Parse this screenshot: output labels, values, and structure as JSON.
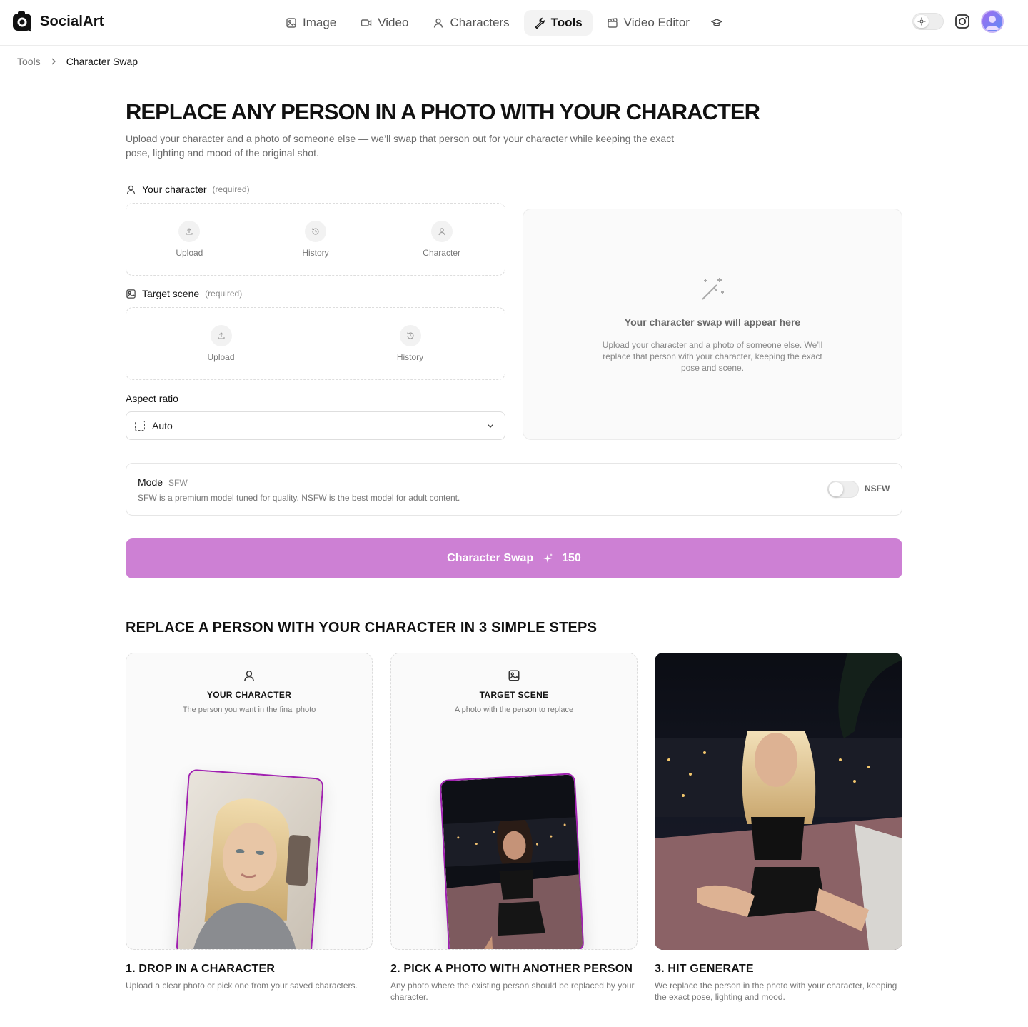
{
  "brand": {
    "name": "SocialArt"
  },
  "nav": {
    "items": [
      {
        "label": "Image",
        "icon": "image-icon"
      },
      {
        "label": "Video",
        "icon": "video-icon"
      },
      {
        "label": "Characters",
        "icon": "user-icon"
      },
      {
        "label": "Tools",
        "icon": "wrench-icon",
        "active": true
      },
      {
        "label": "Video Editor",
        "icon": "clapper-icon"
      }
    ],
    "extra_icon": "graduation-cap-icon"
  },
  "breadcrumb": {
    "parent": "Tools",
    "current": "Character Swap"
  },
  "hero": {
    "title": "REPLACE ANY PERSON IN A PHOTO WITH YOUR CHARACTER",
    "subtitle": "Upload your character and a photo of someone else — we’ll swap that person out for your character while keeping the exact pose, lighting and mood of the original shot."
  },
  "character_input": {
    "label": "Your character",
    "required": "(required)",
    "options": [
      "Upload",
      "History",
      "Character"
    ]
  },
  "scene_input": {
    "label": "Target scene",
    "required": "(required)",
    "options": [
      "Upload",
      "History"
    ]
  },
  "aspect_ratio": {
    "label": "Aspect ratio",
    "value": "Auto"
  },
  "preview": {
    "title": "Your character swap will appear here",
    "description": "Upload your character and a photo of someone else. We’ll replace that person with your character, keeping the exact pose and scene."
  },
  "mode": {
    "label": "Mode",
    "current": "SFW",
    "description": "SFW is a premium model tuned for quality. NSFW is the best model for adult content.",
    "toggle_label": "NSFW",
    "toggle_on": false
  },
  "cta": {
    "label": "Character Swap",
    "cost": "150",
    "color": "#cd80d4"
  },
  "steps": {
    "title": "REPLACE A PERSON WITH YOUR CHARACTER IN 3 SIMPLE STEPS",
    "cards": [
      {
        "title": "YOUR CHARACTER",
        "subtitle": "The person you want in the final photo"
      },
      {
        "title": "TARGET SCENE",
        "subtitle": "A photo with the person to replace"
      }
    ],
    "captions": [
      {
        "title": "1. DROP IN A CHARACTER",
        "desc": "Upload a clear photo or pick one from your saved characters."
      },
      {
        "title": "2. PICK A PHOTO WITH ANOTHER PERSON",
        "desc": "Any photo where the existing person should be replaced by your character."
      },
      {
        "title": "3. HIT GENERATE",
        "desc": "We replace the person in the photo with your character, keeping the exact pose, lighting and mood."
      }
    ]
  },
  "colors": {
    "accent": "#cd80d4",
    "photo_border": "#a020b0"
  }
}
